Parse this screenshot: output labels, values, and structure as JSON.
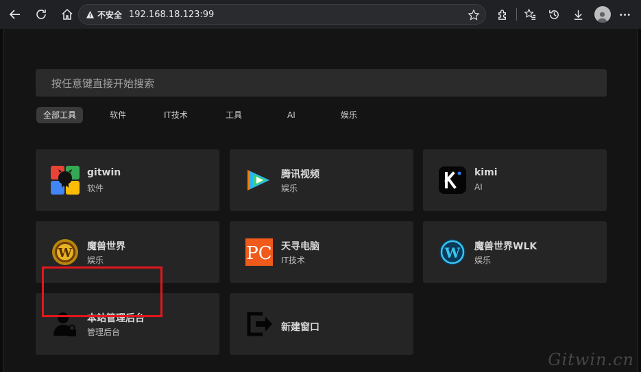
{
  "browser": {
    "security_label": "不安全",
    "url": "192.168.18.123:99"
  },
  "search": {
    "placeholder": "按任意键直接开始搜索"
  },
  "tabs": [
    {
      "label": "全部工具",
      "active": true
    },
    {
      "label": "软件"
    },
    {
      "label": "IT技术"
    },
    {
      "label": "工具"
    },
    {
      "label": "AI"
    },
    {
      "label": "娱乐"
    }
  ],
  "cards": [
    {
      "title": "gitwin",
      "subtitle": "软件",
      "icon": "gitwin-logo-icon"
    },
    {
      "title": "腾讯视频",
      "subtitle": "娱乐",
      "icon": "tencent-video-icon"
    },
    {
      "title": "kimi",
      "subtitle": "AI",
      "icon": "kimi-icon"
    },
    {
      "title": "魔兽世界",
      "subtitle": "娱乐",
      "icon": "wow-icon"
    },
    {
      "title": "天寻电脑",
      "subtitle": "IT技术",
      "icon": "pc-icon"
    },
    {
      "title": "魔兽世界WLK",
      "subtitle": "娱乐",
      "icon": "wlk-icon"
    },
    {
      "title": "本站管理后台",
      "subtitle": "管理后台",
      "icon": "admin-user-icon"
    },
    {
      "title": "新建窗口",
      "icon": "exit-window-icon"
    }
  ],
  "colors": {
    "highlight": "#e2171b",
    "card_bg": "#252525",
    "page_bg": "#141414"
  },
  "watermark": "Gitwin.cn"
}
